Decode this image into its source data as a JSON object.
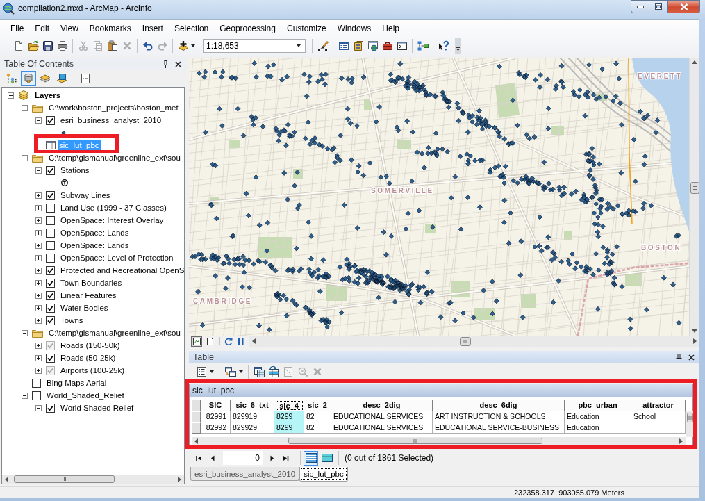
{
  "window": {
    "title": "compilation2.mxd - ArcMap - ArcInfo"
  },
  "menu": [
    "File",
    "Edit",
    "View",
    "Bookmarks",
    "Insert",
    "Selection",
    "Geoprocessing",
    "Customize",
    "Windows",
    "Help"
  ],
  "toolbar": [
    {
      "kind": "new",
      "disabled": false
    },
    {
      "kind": "open",
      "disabled": false
    },
    {
      "kind": "save",
      "disabled": false
    },
    {
      "kind": "print",
      "disabled": false
    },
    {
      "kind": "separator"
    },
    {
      "kind": "cut",
      "disabled": true
    },
    {
      "kind": "copy",
      "disabled": true
    },
    {
      "kind": "paste",
      "disabled": false
    },
    {
      "kind": "delete",
      "disabled": true
    },
    {
      "kind": "separator"
    },
    {
      "kind": "undo",
      "disabled": false
    },
    {
      "kind": "redo",
      "disabled": true
    },
    {
      "kind": "separator"
    },
    {
      "kind": "add_data",
      "disabled": false
    },
    {
      "kind": "scale",
      "value": "1:18,653"
    },
    {
      "kind": "separator"
    },
    {
      "kind": "editor",
      "disabled": false
    },
    {
      "kind": "separator"
    },
    {
      "kind": "toc",
      "disabled": false
    },
    {
      "kind": "catalog",
      "disabled": false
    },
    {
      "kind": "search",
      "disabled": false
    },
    {
      "kind": "toolbox",
      "disabled": false
    },
    {
      "kind": "python",
      "disabled": false
    },
    {
      "kind": "separator"
    },
    {
      "kind": "model_builder",
      "disabled": false
    },
    {
      "kind": "separator"
    },
    {
      "kind": "whats_this",
      "disabled": false
    }
  ],
  "toc": {
    "title": "Table Of Contents",
    "views": [
      {
        "kind": "drawing_order",
        "selected": false
      },
      {
        "kind": "source",
        "selected": true
      },
      {
        "kind": "visibility",
        "selected": false
      },
      {
        "kind": "selection",
        "selected": false
      }
    ],
    "tree": [
      {
        "kind": "data_frame",
        "label": "Layers",
        "expanded": true,
        "selected": false,
        "highlighted": false,
        "children": [
          {
            "kind": "group",
            "label": "C:\\work\\boston_projects\\boston_met",
            "expanded": true,
            "selected": false,
            "highlighted": false,
            "children": [
              {
                "kind": "layer",
                "label": "esri_business_analyst_2010",
                "expanded": true,
                "checked": true,
                "disabled": false,
                "selected": false,
                "highlighted": false,
                "children": [
                  {
                    "kind": "point_symbol"
                  }
                ]
              },
              {
                "kind": "table",
                "label": "sic_lut_pbc",
                "selected": true,
                "highlighted": true
              }
            ]
          },
          {
            "kind": "group",
            "label": "C:\\temp\\gismanual\\greenline_ext\\sou",
            "expanded": true,
            "selected": false,
            "highlighted": false,
            "children": [
              {
                "kind": "layer",
                "label": "Stations",
                "expanded": true,
                "checked": true,
                "disabled": false,
                "selected": false,
                "highlighted": false,
                "children": [
                  {
                    "kind": "station_symbol"
                  }
                ]
              },
              {
                "kind": "layer",
                "label": "Subway Lines",
                "expanded": false,
                "checked": true,
                "disabled": false,
                "selected": false,
                "highlighted": false
              },
              {
                "kind": "layer",
                "label": "Land Use (1999 - 37 Classes)",
                "expanded": false,
                "checked": false,
                "disabled": false,
                "selected": false,
                "highlighted": false
              },
              {
                "kind": "layer",
                "label": "OpenSpace: Interest Overlay",
                "expanded": false,
                "checked": false,
                "disabled": false,
                "selected": false,
                "highlighted": false
              },
              {
                "kind": "layer",
                "label": "OpenSpace: Lands",
                "expanded": false,
                "checked": false,
                "disabled": false,
                "selected": false,
                "highlighted": false
              },
              {
                "kind": "layer",
                "label": "OpenSpace: Lands",
                "expanded": false,
                "checked": false,
                "disabled": false,
                "selected": false,
                "highlighted": false
              },
              {
                "kind": "layer",
                "label": "OpenSpace: Level of Protection",
                "expanded": false,
                "checked": false,
                "disabled": false,
                "selected": false,
                "highlighted": false
              },
              {
                "kind": "layer",
                "label": "Protected and Recreational OpenS",
                "expanded": false,
                "checked": true,
                "disabled": false,
                "selected": false,
                "highlighted": false
              },
              {
                "kind": "layer",
                "label": "Town Boundaries",
                "expanded": false,
                "checked": true,
                "disabled": false,
                "selected": false,
                "highlighted": false
              },
              {
                "kind": "layer",
                "label": "Linear Features",
                "expanded": false,
                "checked": true,
                "disabled": false,
                "selected": false,
                "highlighted": false
              },
              {
                "kind": "layer",
                "label": "Water Bodies",
                "expanded": false,
                "checked": true,
                "disabled": false,
                "selected": false,
                "highlighted": false
              },
              {
                "kind": "layer",
                "label": "Towns",
                "expanded": false,
                "checked": true,
                "disabled": false,
                "selected": false,
                "highlighted": false
              }
            ]
          },
          {
            "kind": "group",
            "label": "C:\\temp\\gismanual\\greenline_ext\\sou",
            "expanded": true,
            "selected": false,
            "highlighted": false,
            "children": [
              {
                "kind": "layer",
                "label": "Roads (150-50k)",
                "expanded": false,
                "checked": true,
                "disabled": true,
                "selected": false,
                "highlighted": false
              },
              {
                "kind": "layer",
                "label": "Roads (50-25k)",
                "expanded": false,
                "checked": true,
                "disabled": false,
                "selected": false,
                "highlighted": false
              },
              {
                "kind": "layer",
                "label": "Airports (100-25k)",
                "expanded": false,
                "checked": true,
                "disabled": true,
                "selected": false,
                "highlighted": false
              }
            ]
          },
          {
            "kind": "layer",
            "label": "Bing Maps Aerial",
            "checked": false,
            "disabled": false,
            "selected": false,
            "highlighted": false
          },
          {
            "kind": "layer",
            "label": "World_Shaded_Relief",
            "expanded": true,
            "checked": false,
            "disabled": false,
            "selected": false,
            "highlighted": false,
            "children": [
              {
                "kind": "layer",
                "label": "World Shaded Relief",
                "expanded": true,
                "checked": true,
                "disabled": false,
                "selected": false,
                "highlighted": false
              }
            ]
          }
        ]
      }
    ]
  },
  "map": {
    "views": [
      {
        "kind": "data",
        "selected": true
      },
      {
        "kind": "layout",
        "selected": false
      }
    ],
    "labels": [
      "EVERETT",
      "SOMERVILLE",
      "BOSTON",
      "CAMBRIDGE"
    ]
  },
  "table_window": {
    "title": "Table",
    "highlighted": true,
    "tools": [
      {
        "kind": "table_options",
        "disabled": false
      },
      {
        "kind": "separator"
      },
      {
        "kind": "related_tables",
        "disabled": false
      },
      {
        "kind": "separator"
      },
      {
        "kind": "select_by_attributes",
        "disabled": false
      },
      {
        "kind": "switch_selection",
        "disabled": false
      },
      {
        "kind": "clear_selection",
        "disabled": true
      },
      {
        "kind": "zoom_to_selected",
        "disabled": true
      },
      {
        "kind": "delete_selected",
        "disabled": true
      }
    ],
    "table_name": "sic_lut_pbc",
    "columns": [
      {
        "label": "SIC",
        "kind": "number",
        "selected": false
      },
      {
        "label": "sic_6_txt",
        "kind": "text",
        "selected": false
      },
      {
        "label": "sic_4",
        "kind": "text",
        "selected": true
      },
      {
        "label": "sic_2",
        "kind": "text",
        "selected": false
      },
      {
        "label": "desc_2dig",
        "kind": "text",
        "selected": false
      },
      {
        "label": "desc_6dig",
        "kind": "text",
        "selected": false
      },
      {
        "label": "pbc_urban",
        "kind": "text",
        "selected": false
      },
      {
        "label": "attractor",
        "kind": "text",
        "selected": false
      }
    ],
    "rows": [
      [
        "82991",
        "829919",
        "8299",
        "82",
        "EDUCATIONAL SERVICES",
        "ART INSTRUCTION & SCHOOLS",
        "Education",
        "School"
      ],
      [
        "82992",
        "829929",
        "8299",
        "82",
        "EDUCATIONAL SERVICES",
        "EDUCATIONAL SERVICE-BUSINESS",
        "Education",
        null
      ]
    ],
    "record": "0",
    "display_modes": [
      {
        "kind": "all",
        "selected": true
      },
      {
        "kind": "selected",
        "selected": false
      }
    ],
    "selection_summary": "(0 out of 1861 Selected)",
    "tabs": [
      {
        "label": "esri_business_analyst_2010",
        "selected": false
      },
      {
        "label": "sic_lut_pbc",
        "selected": true
      }
    ]
  },
  "status_bar": {
    "coordinates": "232358.317  903055.079 Meters"
  }
}
